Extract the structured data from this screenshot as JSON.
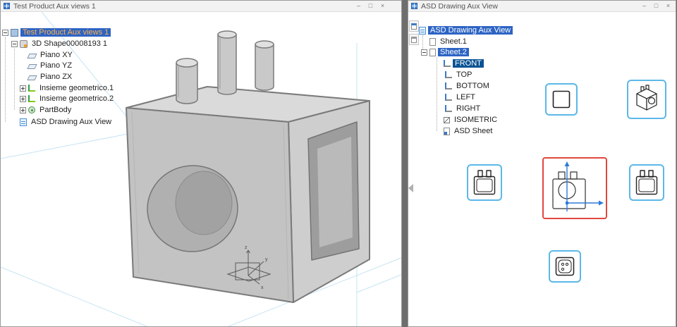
{
  "app": {
    "background": "#6e6e6e"
  },
  "left_window": {
    "title": "Test Product Aux views 1",
    "controls": {
      "minimize": "–",
      "maximize": "□",
      "close": "×"
    },
    "tree": {
      "items": [
        {
          "label": "Test Product Aux views 1",
          "selected": true
        },
        {
          "label": "3D Shape00008193 1"
        },
        {
          "label": "Piano XY"
        },
        {
          "label": "Piano YZ"
        },
        {
          "label": "Piano ZX"
        },
        {
          "label": "Insieme geometrico.1"
        },
        {
          "label": "Insieme geometrico.2"
        },
        {
          "label": "PartBody"
        },
        {
          "label": "ASD Drawing Aux View"
        }
      ]
    },
    "viewport": {
      "axis": {
        "x": "x",
        "y": "y",
        "z": "z"
      },
      "grid_color": "#c5e4f2",
      "model_color": "#c4c4c4"
    }
  },
  "right_window": {
    "title": "ASD Drawing Aux View",
    "controls": {
      "minimize": "–",
      "maximize": "□",
      "close": "×"
    },
    "tree": {
      "items": [
        {
          "label": "ASD Drawing Aux View",
          "selected": true
        },
        {
          "label": "Sheet.1"
        },
        {
          "label": "Sheet.2",
          "selected": true
        },
        {
          "label": "FRONT",
          "selected": true
        },
        {
          "label": "TOP"
        },
        {
          "label": "BOTTOM"
        },
        {
          "label": "LEFT"
        },
        {
          "label": "RIGHT"
        },
        {
          "label": "ISOMETRIC"
        },
        {
          "label": "ASD Sheet"
        }
      ]
    },
    "sheet": {
      "views": [
        {
          "name": "bottom-view-thumbnail"
        },
        {
          "name": "isometric-view-thumbnail"
        },
        {
          "name": "left-view-thumbnail"
        },
        {
          "name": "front-view-thumbnail",
          "selected": true
        },
        {
          "name": "right-view-thumbnail"
        },
        {
          "name": "top-view-thumbnail"
        }
      ],
      "thumbnail_border_color": "#5bb8e8",
      "selected_border_color": "#e0483e",
      "axis_arrow_color": "#2e7bd6"
    }
  },
  "colors": {
    "selection_blue": "#2d64c4",
    "selection_dark_blue": "#0b5394",
    "selection_text_orange": "#ffb24d"
  }
}
